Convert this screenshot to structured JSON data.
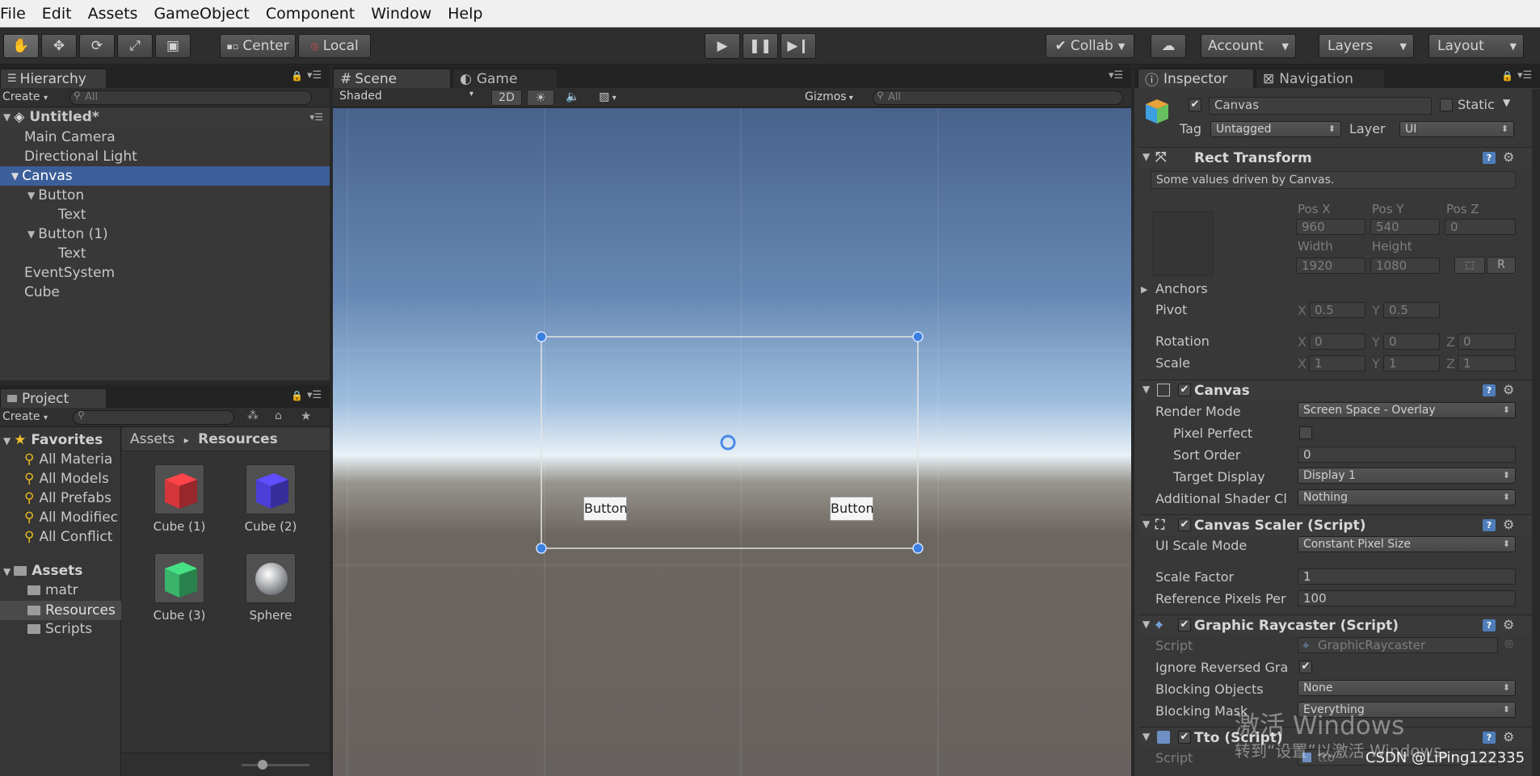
{
  "menu": [
    "File",
    "Edit",
    "Assets",
    "GameObject",
    "Component",
    "Window",
    "Help"
  ],
  "toolbar": {
    "pivot": "Center",
    "space": "Local",
    "collab": "Collab",
    "account": "Account",
    "layers": "Layers",
    "layout": "Layout"
  },
  "hierarchy": {
    "tab": "Hierarchy",
    "create": "Create",
    "search_placeholder": "All",
    "scene": "Untitled*",
    "items": [
      "Main Camera",
      "Directional Light",
      "Canvas",
      "Button",
      "Text",
      "Button (1)",
      "Text",
      "EventSystem",
      "Cube"
    ]
  },
  "project": {
    "tab": "Project",
    "create": "Create",
    "favorites_label": "Favorites",
    "favorites": [
      "All Materia",
      "All Models",
      "All Prefabs",
      "All Modifiec",
      "All Conflict"
    ],
    "assets_label": "Assets",
    "folders": [
      "matr",
      "Resources",
      "Scripts"
    ],
    "breadcrumb_root": "Assets",
    "breadcrumb_sep": "▸",
    "breadcrumb_leaf": "Resources",
    "assets": [
      {
        "name": "Cube (1)",
        "color": "#d2363b"
      },
      {
        "name": "Cube (2)",
        "color": "#4c3ed6"
      },
      {
        "name": "Cube (3)",
        "color": "#39b46a"
      },
      {
        "name": "Sphere",
        "color": "#cfd5dd"
      }
    ]
  },
  "scene": {
    "tab_scene": "Scene",
    "tab_game": "Game",
    "shading": "Shaded",
    "mode_2d": "2D",
    "gizmos": "Gizmos",
    "search_placeholder": "All",
    "button1": "Button",
    "button2": "Button"
  },
  "inspector": {
    "tab": "Inspector",
    "tab_nav": "Navigation",
    "object_name": "Canvas",
    "static_label": "Static",
    "tag_label": "Tag",
    "tag_value": "Untagged",
    "layer_label": "Layer",
    "layer_value": "UI",
    "rect_transform": {
      "title": "Rect Transform",
      "note": "Some values driven by Canvas.",
      "posx_label": "Pos X",
      "posy_label": "Pos Y",
      "posz_label": "Pos Z",
      "posx": "960",
      "posy": "540",
      "posz": "0",
      "width_label": "Width",
      "height_label": "Height",
      "width": "1920",
      "height": "1080",
      "r_button": "R",
      "anchors": "Anchors",
      "pivot": "Pivot",
      "pivot_x": "0.5",
      "pivot_y": "0.5",
      "rotation": "Rotation",
      "rot_x": "0",
      "rot_y": "0",
      "rot_z": "0",
      "scale": "Scale",
      "scale_x": "1",
      "scale_y": "1",
      "scale_z": "1",
      "x": "X",
      "y": "Y",
      "z": "Z"
    },
    "canvas": {
      "title": "Canvas",
      "render_mode_label": "Render Mode",
      "render_mode": "Screen Space - Overlay",
      "pixel_perfect": "Pixel Perfect",
      "sort_order_label": "Sort Order",
      "sort_order": "0",
      "target_display_label": "Target Display",
      "target_display": "Display 1",
      "shader_label": "Additional Shader Cl",
      "shader": "Nothing"
    },
    "canvas_scaler": {
      "title": "Canvas Scaler (Script)",
      "ui_scale_label": "UI Scale Mode",
      "ui_scale": "Constant Pixel Size",
      "scale_factor_label": "Scale Factor",
      "scale_factor": "1",
      "ref_px_label": "Reference Pixels Per",
      "ref_px": "100"
    },
    "raycaster": {
      "title": "Graphic Raycaster (Script)",
      "script_label": "Script",
      "script": "GraphicRaycaster",
      "ignore_label": "Ignore Reversed Gra",
      "blocking_objects_label": "Blocking Objects",
      "blocking_objects": "None",
      "blocking_mask_label": "Blocking Mask",
      "blocking_mask": "Everything"
    },
    "tto": {
      "title": "Tto (Script)",
      "script_label": "Script",
      "script": "tto"
    }
  },
  "watermark": {
    "line1": "激活 Windows",
    "line2": "转到“设置”以激活 Windows。",
    "credit": "CSDN @LiPing122335"
  }
}
